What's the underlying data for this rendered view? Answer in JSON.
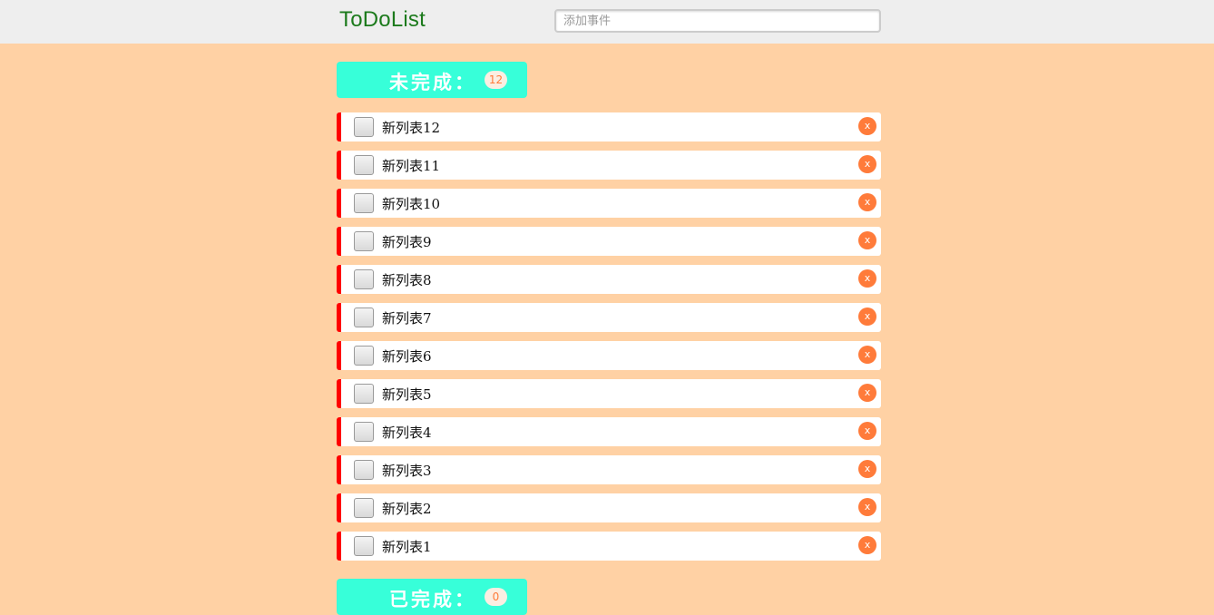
{
  "header": {
    "logo": "ToDoList",
    "search_placeholder": "添加事件"
  },
  "incomplete": {
    "title": "未完成：",
    "count": "12",
    "items": [
      {
        "text": "新列表12",
        "delete": "x"
      },
      {
        "text": "新列表11",
        "delete": "x"
      },
      {
        "text": "新列表10",
        "delete": "x"
      },
      {
        "text": "新列表9",
        "delete": "x"
      },
      {
        "text": "新列表8",
        "delete": "x"
      },
      {
        "text": "新列表7",
        "delete": "x"
      },
      {
        "text": "新列表6",
        "delete": "x"
      },
      {
        "text": "新列表5",
        "delete": "x"
      },
      {
        "text": "新列表4",
        "delete": "x"
      },
      {
        "text": "新列表3",
        "delete": "x"
      },
      {
        "text": "新列表2",
        "delete": "x"
      },
      {
        "text": "新列表1",
        "delete": "x"
      }
    ]
  },
  "completed": {
    "title": "已完成：",
    "count": "0"
  },
  "colors": {
    "background": "#ffd1a4",
    "header_bg": "#eeeeee",
    "logo": "#1c7a1c",
    "section_header": "#37ffd9",
    "item_accent": "#ff0000",
    "delete_button": "#ff7b3a"
  }
}
